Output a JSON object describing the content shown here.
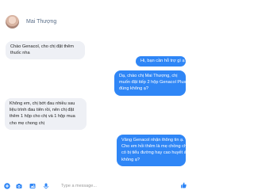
{
  "header": {
    "contact_name": "Mai Thượng"
  },
  "messages": [
    {
      "direction": "incoming",
      "lines": [
        "Chào Genacol, cho chị đặt thêm",
        "thuốc nha"
      ]
    },
    {
      "direction": "outgoing",
      "lines": [
        "Hi, bạn cần hỗ trợ gì ạ?"
      ]
    },
    {
      "direction": "outgoing",
      "lines": [
        "Dạ, chào chị Mai Thượng, chị",
        "muốn đặt tiếp 2 hộp Genacol Plus",
        "đúng không ạ?"
      ]
    },
    {
      "direction": "incoming",
      "lines": [
        "Không em, chị bớt đau nhiều sau",
        "liệu trình đau tiên rồi, nên chị đặt",
        "thêm 1 hộp cho chị và 1 hộp mua",
        "cho mẹ chong chị"
      ]
    },
    {
      "direction": "outgoing",
      "lines": [
        "Vâng Genacol nhận thông tin ạ.",
        "Cho em hỏi thêm là mẹ chồng chị",
        "có bị tiểu đường hay cao huyết áp",
        "không ạ?"
      ]
    }
  ],
  "composer": {
    "placeholder": "Type a message...",
    "icons": [
      "plus-circle-icon",
      "camera-icon",
      "photo-icon",
      "microphone-icon",
      "thumbs-up-icon"
    ]
  },
  "colors": {
    "outgoing_bubble": "#2f86f6",
    "incoming_bubble": "#eef0f5",
    "accent": "#2f86f6"
  }
}
